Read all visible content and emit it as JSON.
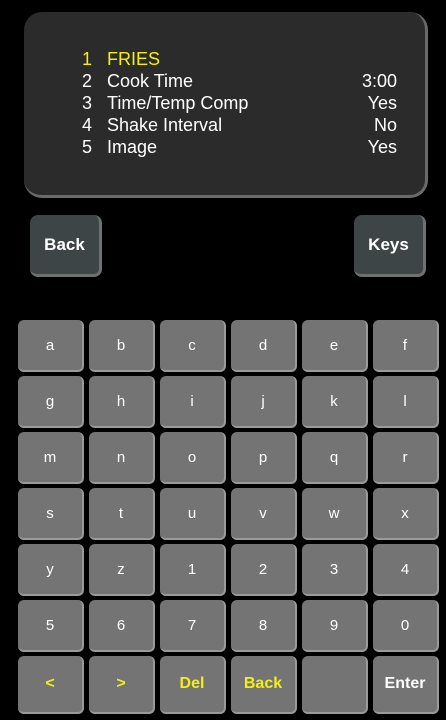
{
  "display": {
    "rows": [
      {
        "num": "1",
        "label": "FRIES",
        "value": "",
        "selected": true
      },
      {
        "num": "2",
        "label": "Cook Time",
        "value": "3:00",
        "selected": false
      },
      {
        "num": "3",
        "label": "Time/Temp Comp",
        "value": "Yes",
        "selected": false
      },
      {
        "num": "4",
        "label": "Shake Interval",
        "value": "No",
        "selected": false
      },
      {
        "num": "5",
        "label": "Image",
        "value": "Yes",
        "selected": false
      }
    ]
  },
  "buttons": {
    "back_label": "Back",
    "keys_label": "Keys"
  },
  "keyboard": {
    "rows": [
      [
        "a",
        "b",
        "c",
        "d",
        "e",
        "f"
      ],
      [
        "g",
        "h",
        "i",
        "j",
        "k",
        "l"
      ],
      [
        "m",
        "n",
        "o",
        "p",
        "q",
        "r"
      ],
      [
        "s",
        "t",
        "u",
        "v",
        "w",
        "x"
      ],
      [
        "y",
        "z",
        "1",
        "2",
        "3",
        "4"
      ],
      [
        "5",
        "6",
        "7",
        "8",
        "9",
        "0"
      ],
      [
        "<",
        ">",
        "Del",
        "Back",
        "",
        "Enter"
      ]
    ]
  },
  "colors": {
    "background": "#000000",
    "panel": "#2b2b2b",
    "key": "#747474",
    "button": "#3e4547",
    "highlight": "#f4ee18",
    "text": "#ffffff"
  }
}
